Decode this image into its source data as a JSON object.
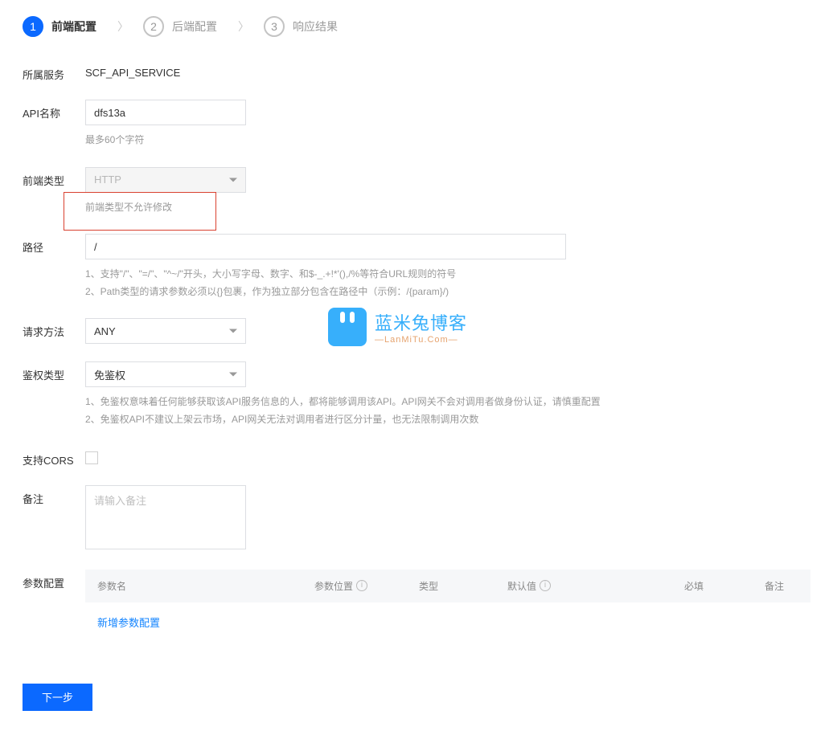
{
  "steps": {
    "s1": {
      "num": "1",
      "label": "前端配置"
    },
    "s2": {
      "num": "2",
      "label": "后端配置"
    },
    "s3": {
      "num": "3",
      "label": "响应结果"
    }
  },
  "labels": {
    "service": "所属服务",
    "api_name": "API名称",
    "frontend_type": "前端类型",
    "path": "路径",
    "method": "请求方法",
    "auth": "鉴权类型",
    "cors": "支持CORS",
    "remark": "备注",
    "params": "参数配置"
  },
  "values": {
    "service": "SCF_API_SERVICE",
    "api_name": "dfs13a",
    "frontend_type": "HTTP",
    "path": "/",
    "method": "ANY",
    "auth": "免鉴权",
    "remark_placeholder": "请输入备注"
  },
  "hints": {
    "api_name": "最多60个字符",
    "frontend_type": "前端类型不允许修改",
    "path1": "1、支持\"/\"、\"=/\"、\"^~/\"开头，大小写字母、数字、和$-_.+!*'(),/%等符合URL规则的符号",
    "path2": "2、Path类型的请求参数必须以{}包裹，作为独立部分包含在路径中（示例：/{param}/)",
    "auth1": "1、免鉴权意味着任何能够获取该API服务信息的人，都将能够调用该API。API网关不会对调用者做身份认证，请慎重配置",
    "auth2": "2、免鉴权API不建议上架云市场，API网关无法对调用者进行区分计量，也无法限制调用次数"
  },
  "table": {
    "name": "参数名",
    "position": "参数位置",
    "type": "类型",
    "default": "默认值",
    "required": "必填",
    "remark": "备注",
    "add": "新增参数配置"
  },
  "buttons": {
    "next": "下一步"
  },
  "watermark": {
    "cn": "蓝米兔博客",
    "en": "—LanMiTu.Com—"
  },
  "icons": {
    "info": "i"
  }
}
